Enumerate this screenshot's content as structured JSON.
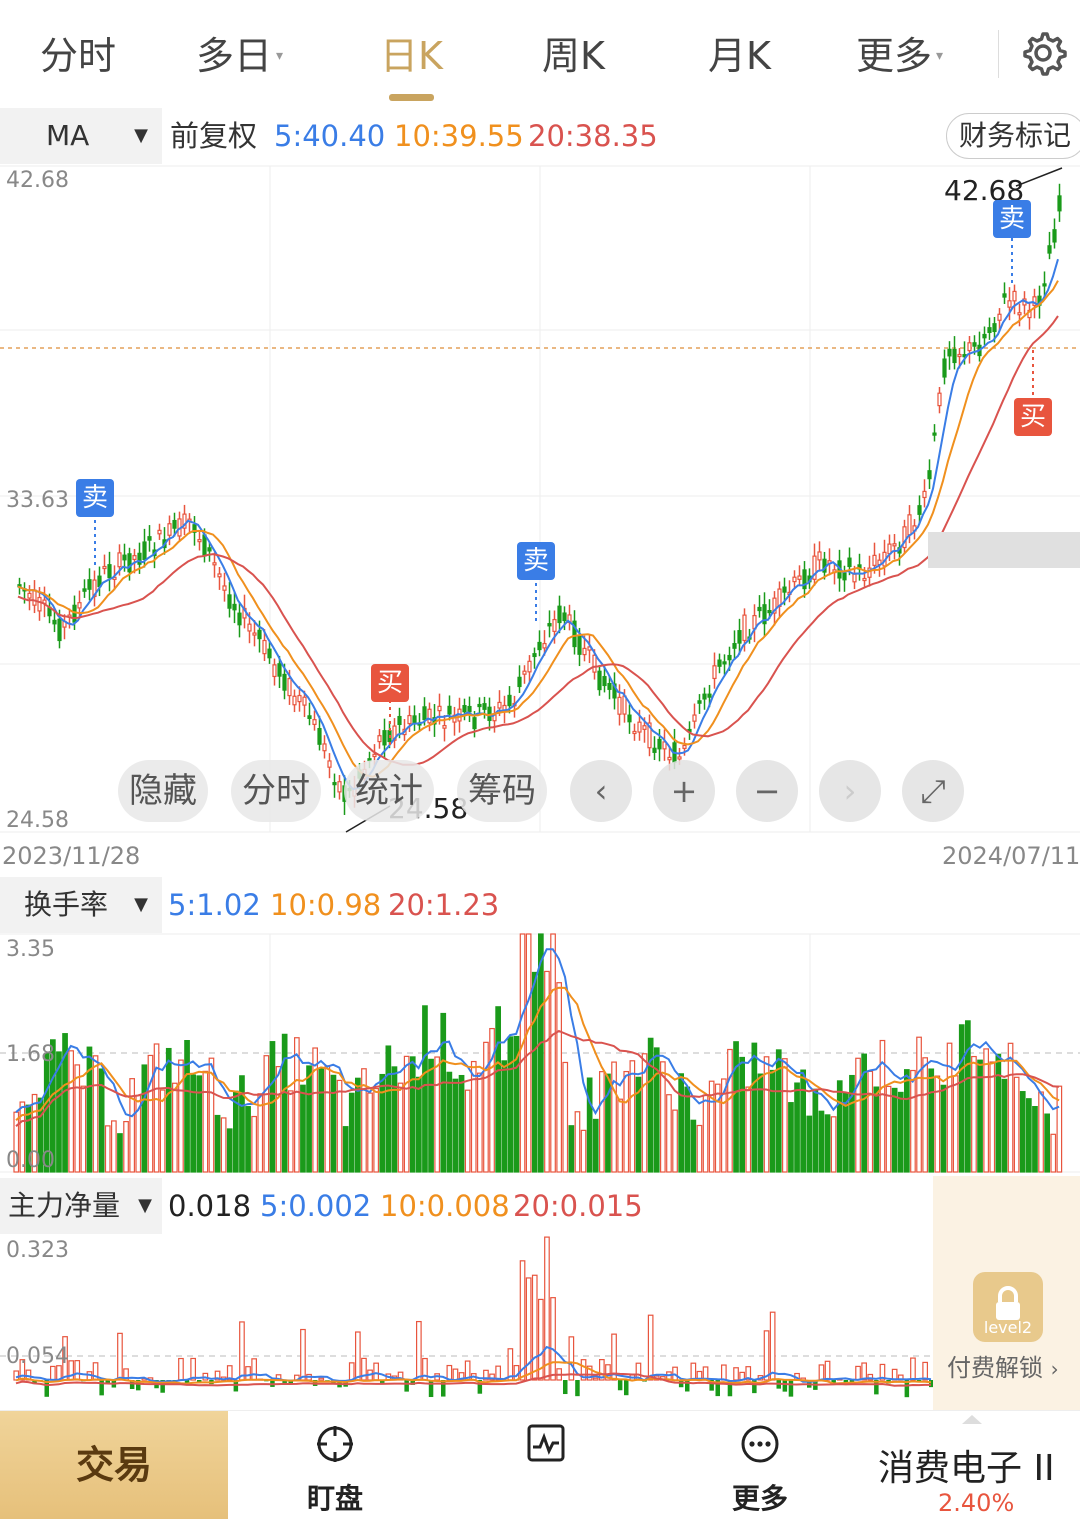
{
  "tabs": [
    {
      "label": "分时",
      "caret": false,
      "active": false
    },
    {
      "label": "多日",
      "caret": true,
      "active": false
    },
    {
      "label": "日K",
      "caret": false,
      "active": true
    },
    {
      "label": "周K",
      "caret": false,
      "active": false
    },
    {
      "label": "月K",
      "caret": false,
      "active": false
    },
    {
      "label": "更多",
      "caret": true,
      "active": false
    }
  ],
  "main_indicator": {
    "selector": "MA",
    "adjust": "前复权",
    "ma5": "5:40.40",
    "ma10": "10:39.55",
    "ma20": "20:38.35",
    "finance_button": "财务标记"
  },
  "price_axis": {
    "top": "42.68",
    "mid": "33.63",
    "bottom": "24.58",
    "max_label": "42.68",
    "min_label": "24.58"
  },
  "dates": {
    "start": "2023/11/28",
    "end": "2024/07/11"
  },
  "signals": {
    "sell": "卖",
    "buy": "买"
  },
  "overlay_buttons": {
    "hide": "隐藏",
    "timeshare": "分时",
    "stats": "统计",
    "chips": "筹码"
  },
  "turnover": {
    "selector": "换手率",
    "ma5": "5:1.02",
    "ma10": "10:0.98",
    "ma20": "20:1.23",
    "axis_top": "3.35",
    "axis_mid": "1.68",
    "axis_bottom": "0.00"
  },
  "capital": {
    "selector": "主力净量",
    "value": "0.018",
    "ma5": "5:0.002",
    "ma10": "10:0.008",
    "ma20": "20:0.015",
    "axis_top": "0.323",
    "axis_mid": "0.054"
  },
  "unlock": {
    "badge": "level2",
    "text": "付费解锁"
  },
  "bottom_bar": {
    "trade": "交易",
    "watch": "盯盘",
    "more": "更多",
    "sector": "消费电子 II",
    "sector_change": "2.40%"
  },
  "colors": {
    "up": "#e8553e",
    "down": "#1a9a1a",
    "ma5": "#3a7de6",
    "ma10": "#f0901e",
    "ma20": "#d9534f",
    "accent": "#c9a45f"
  }
}
